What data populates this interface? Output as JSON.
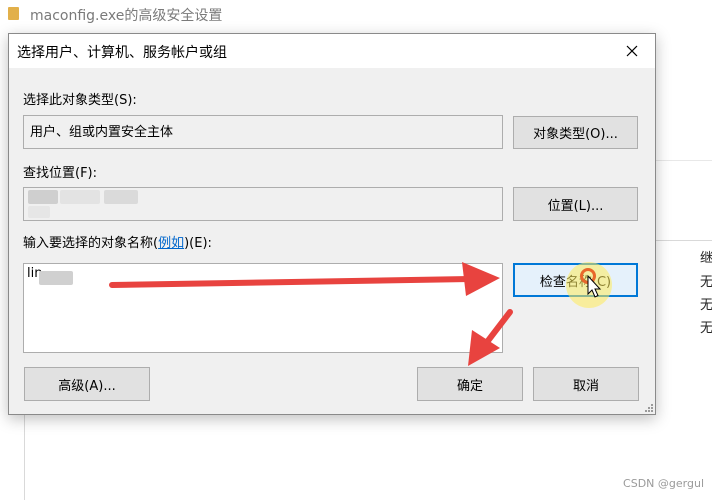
{
  "background_window": {
    "title": "maconfig.exe的高级安全设置",
    "right_cells": [
      "继",
      "无",
      "无",
      "无"
    ]
  },
  "dialog": {
    "title": "选择用户、计算机、服务帐户或组",
    "object_type": {
      "label": "选择此对象类型(S):",
      "value": "用户、组或内置安全主体",
      "button_label": "对象类型(O)..."
    },
    "location": {
      "label": "查找位置(F):",
      "button_label": "位置(L)..."
    },
    "object_names": {
      "label_prefix": "输入要选择的对象名称(",
      "label_link": "例如",
      "label_suffix": ")(E):",
      "value": "lin",
      "check_names_button": "检查名称(C)"
    },
    "advanced_button": "高级(A)...",
    "ok_button": "确定",
    "cancel_button": "取消"
  },
  "watermark": "CSDN @gergul",
  "colors": {
    "annotation_arrow": "#e8433f",
    "highlight": "#ffeb5a",
    "link": "#0066cc",
    "focus_border": "#0078d7"
  }
}
